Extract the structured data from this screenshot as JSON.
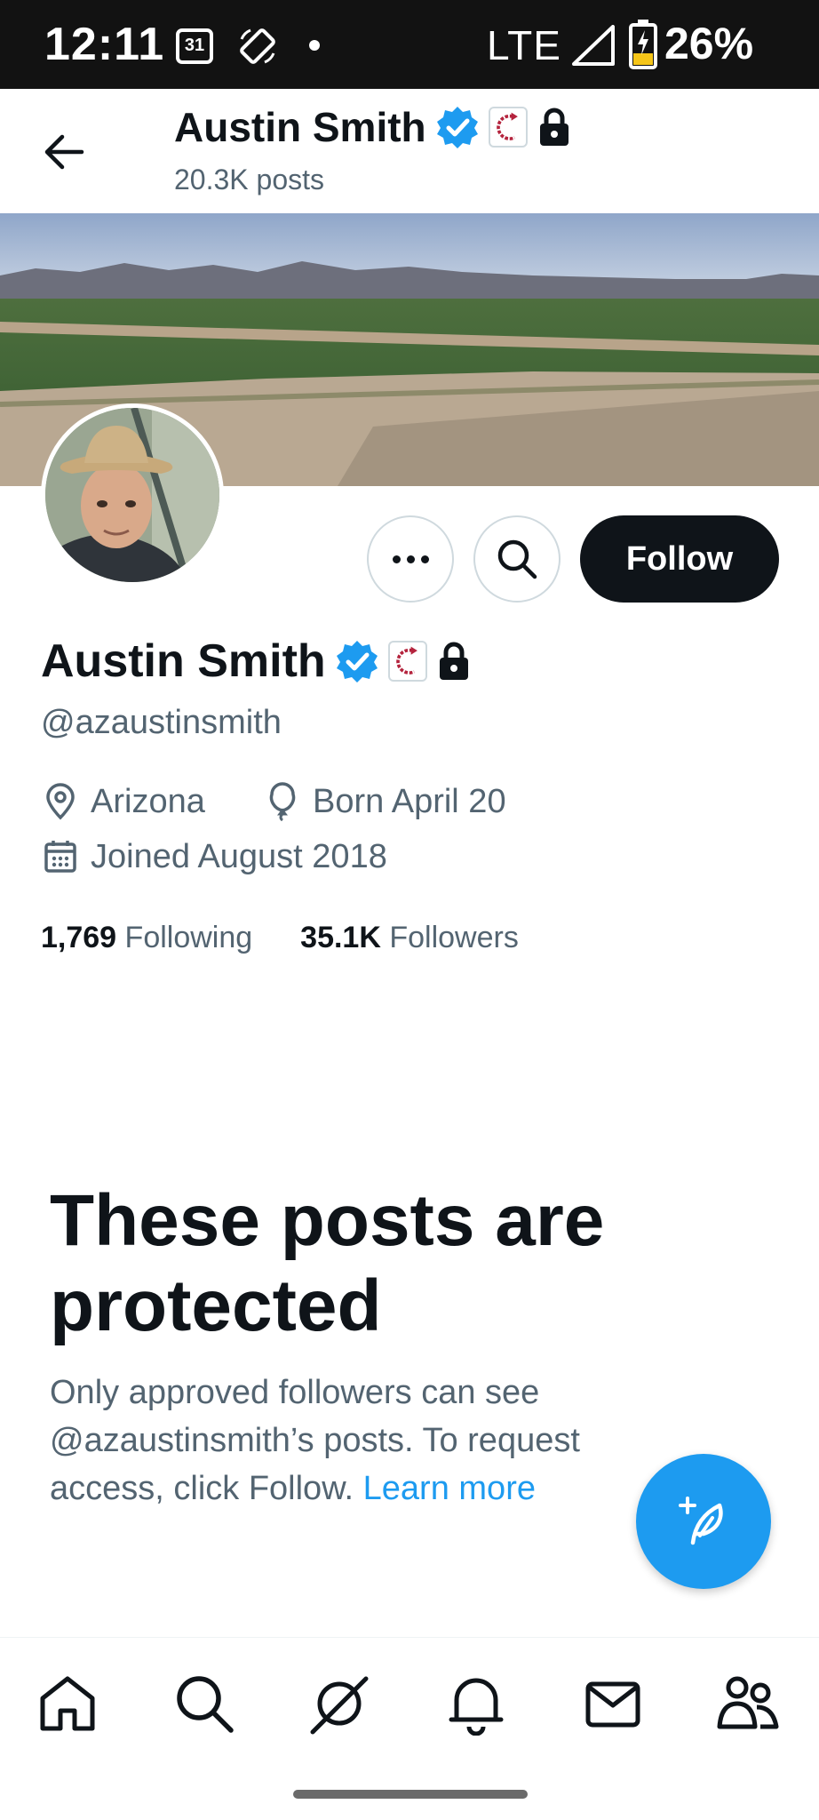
{
  "status_bar": {
    "time": "12:11",
    "calendar_day": "31",
    "network": "LTE",
    "battery": "26%"
  },
  "header": {
    "name": "Austin Smith",
    "posts_count": "20.3K posts"
  },
  "profile": {
    "name": "Austin Smith",
    "handle": "@azaustinsmith",
    "location": "Arizona",
    "birthday": "Born April 20",
    "joined": "Joined August 2018",
    "following_count": "1,769",
    "following_label": "Following",
    "followers_count": "35.1K",
    "followers_label": "Followers"
  },
  "actions": {
    "follow_label": "Follow"
  },
  "protected": {
    "title": "These posts are protected",
    "body": "Only approved followers can see @azaustinsmith’s posts. To request access, click Follow.",
    "learn_more": "Learn more"
  },
  "colors": {
    "accent": "#1d9bf0",
    "text": "#0f1419",
    "secondary": "#536471",
    "status_bar_bg": "#121212"
  },
  "icons": {
    "back": "arrow-left-icon",
    "verified": "verified-badge-icon",
    "affiliate": "affiliate-badge-icon",
    "lock": "lock-icon",
    "more": "more-horizontal-icon",
    "search": "search-icon",
    "location": "location-pin-icon",
    "birthday": "balloon-icon",
    "calendar": "calendar-icon",
    "compose": "compose-post-icon",
    "nav": [
      "home-icon",
      "explore-icon",
      "grok-icon",
      "notifications-icon",
      "messages-icon",
      "communities-icon"
    ]
  }
}
